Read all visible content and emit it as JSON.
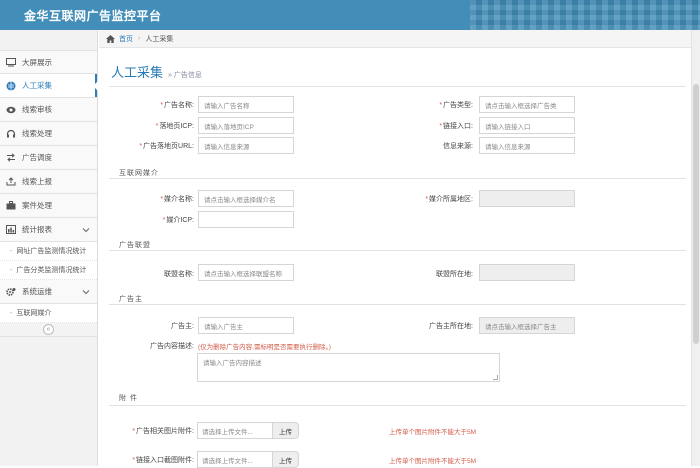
{
  "header": {
    "title": "金华互联网广告监控平台"
  },
  "sidebar": {
    "items": [
      {
        "label": "大屏展示",
        "icon": "monitor-icon"
      },
      {
        "label": "人工采集",
        "icon": "globe-icon",
        "active": true
      },
      {
        "label": "线索审核",
        "icon": "eye-icon"
      },
      {
        "label": "线索处理",
        "icon": "headset-icon"
      },
      {
        "label": "广告调度",
        "icon": "swap-arrows-icon"
      },
      {
        "label": "线索上报",
        "icon": "upload-tray-icon"
      },
      {
        "label": "案件处理",
        "icon": "briefcase-icon"
      },
      {
        "label": "统计报表",
        "icon": "bar-chart-icon",
        "expandable": true
      }
    ],
    "report_sub": [
      "网址广告监测情况统计",
      "广告分类监测情况统计"
    ],
    "system": {
      "label": "系统运维",
      "icon": "gears-icon"
    },
    "system_sub": [
      "互联网媒介"
    ]
  },
  "breadcrumb": {
    "home": "首页",
    "current": "人工采集"
  },
  "page": {
    "title": "人工采集",
    "subtitle": "广告信息"
  },
  "form": {
    "ad_name": {
      "label": "广告名称:",
      "placeholder": "请输入广告名称"
    },
    "ad_type": {
      "label": "广告类型:",
      "placeholder": "请点击输入框选择广告类"
    },
    "icp": {
      "label": "落地页ICP:",
      "placeholder": "请输入落地页ICP"
    },
    "entry": {
      "label": "链接入口:",
      "placeholder": "请输入链接入口"
    },
    "url": {
      "label": "广告落地页URL:",
      "placeholder": "请输入信息来源"
    },
    "source": {
      "label": "信息来源:",
      "placeholder": "请输入信息来源"
    },
    "sec_media": "互联网媒介",
    "media_name": {
      "label": "媒介名称:",
      "placeholder": "请点击输入框选择媒介名"
    },
    "media_region": {
      "label": "媒介所属地区:",
      "placeholder": ""
    },
    "media_icp": {
      "label": "媒介ICP:",
      "placeholder": ""
    },
    "sec_alliance": "广告联盟",
    "alliance_name": {
      "label": "联盟名称:",
      "placeholder": "请点击输入框选择联盟名称"
    },
    "alliance_loc": {
      "label": "联盟所在地:",
      "placeholder": ""
    },
    "sec_advertiser": "广告主",
    "advertiser": {
      "label": "广告主:",
      "placeholder": "请输入广告主"
    },
    "advertiser_loc": {
      "label": "广告主所在地:",
      "placeholder": "请点击输入框选择广告主"
    },
    "desc": {
      "label": "广告内容描述:",
      "note": "(仅为删除广告内容,需标明是否需要执行删除。)",
      "placeholder": "请输入广告内容描述"
    },
    "sec_attach": "附 件",
    "attach1": {
      "label": "广告相关图片附件:",
      "placeholder": "请选择上传文件...",
      "button": "上传",
      "note": "上传单个图片附件不能大于5M"
    },
    "attach2": {
      "label": "链接入口截图附件:",
      "placeholder": "请选择上传文件...",
      "button": "上传",
      "note": "上传单个图片附件不能大于5M"
    }
  },
  "colors": {
    "header": "#438eb9",
    "accent": "#2b7dbc",
    "required": "#d15b47"
  }
}
